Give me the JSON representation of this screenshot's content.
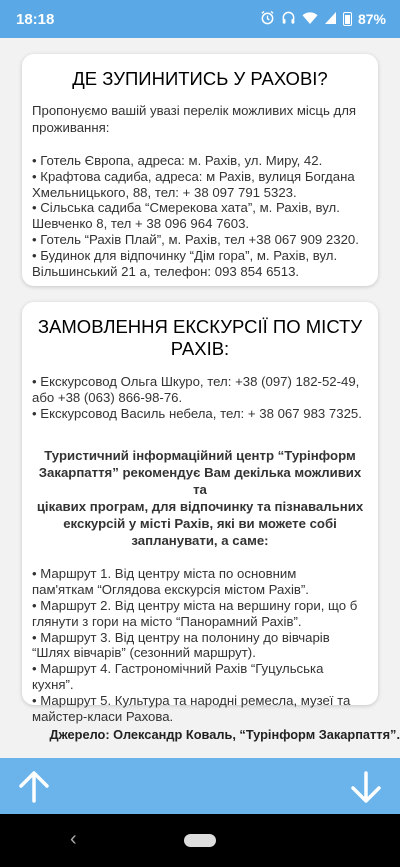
{
  "status_bar": {
    "time": "18:18",
    "battery": "87%"
  },
  "card1": {
    "title": "ДЕ ЗУПИНИТИСЬ У РАХОВІ?",
    "intro": "Пропонуємо вашій увазі перелік можливих місць для проживання:",
    "items": [
      " • Готель Європа, адреса: м. Рахів, ул. Миру, 42.",
      " • Крафтова садиба, адреса: м Рахів, вулиця Богдана",
      "Хмельницького, 88, тел: + 38 097 791 5323.",
      " • Сільська садиба “Смерекова хата”, м. Рахів, вул.",
      "Шевченко 8, тел + 38 096 964 7603.",
      " • Готель “Рахів Плай”, м. Рахів, тел +38 067 909 2320.",
      " • Будинок для відпочинку “Дім гора”, м. Рахів, вул.",
      "Вільшинський 21 а, телефон: 093 854 6513."
    ]
  },
  "card2": {
    "title_line1": "ЗАМОВЛЕННЯ ЕКСКУРСІЇ ПО МІСТУ",
    "title_line2": "РАХІВ:",
    "guides": [
      "• Екскурсовод Ольга Шкуро, тел: +38 (097) 182-52-49,",
      " або +38 (063) 866-98-76.",
      " • Екскурсовод Василь небела, тел: + 38 067 983 7325."
    ],
    "info_lines": [
      "Туристичний інформаційний центр “Турінформ",
      "Закарпаття” рекомендує Вам декілька можливих та",
      "цікавих програм, для відпочинку та пізнавальних",
      "екскурсій у місті Рахів, які ви можете собі",
      "запланувати, а саме:"
    ],
    "routes": [
      "• Маршрут 1. Від центру міста по основним",
      "пам'яткам “Оглядова екскурсія містом Рахів”.",
      " • Маршрут 2. Від центру міста на вершину гори, що б",
      " глянути з гори на місто “Панорамний Рахів”.",
      " • Маршрут 3. Від центру на полонину до вівчарів",
      "“Шлях вівчарів” (сезонний маршрут).",
      " • Маршрут 4. Гастрономічний Рахів “Гуцульська",
      "кухня”.",
      " • Маршрут 5. Культура та народні ремесла, музеї та",
      "майстер-класи Рахова."
    ]
  },
  "source": "Джерело: Олександр Коваль, “Турінформ Закарпаття”."
}
